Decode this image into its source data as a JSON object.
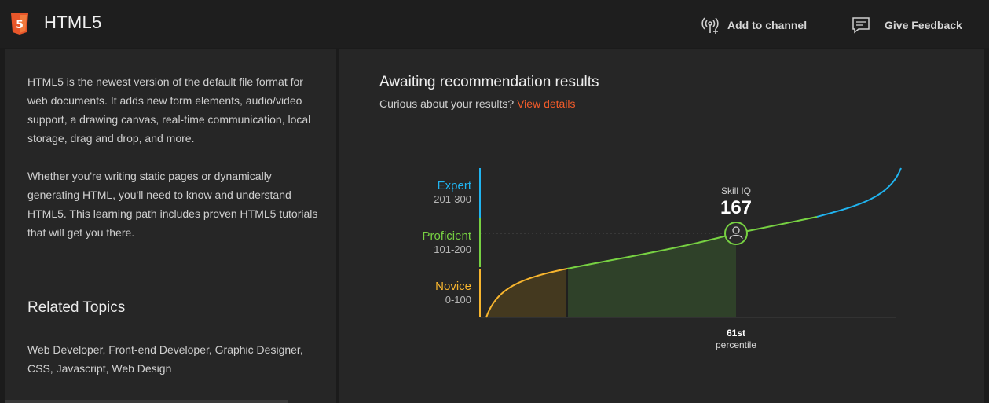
{
  "header": {
    "app_title": "HTML5",
    "logo_text": "5",
    "add_to_channel": "Add to channel",
    "give_feedback": "Give Feedback"
  },
  "left": {
    "desc_1": "HTML5 is the newest version of the default file format for web documents. It adds new form elements, audio/video support, a drawing canvas, real-time communication, local storage, drag and drop, and more.",
    "desc_2": "Whether you're writing static pages or dynamically generating HTML, you'll need to know and understand HTML5. This learning path includes proven HTML5 tutorials that will get you there.",
    "related_title": "Related Topics",
    "related_list": "Web Developer, Front-end Developer, Graphic Designer, CSS, Javascript, Web Design"
  },
  "right": {
    "title": "Awaiting recommendation results",
    "subtitle": "Curious about your results?",
    "link": "View details"
  },
  "skill": {
    "levels": [
      {
        "name": "Expert",
        "range": "201-300",
        "color": "#20b4f0"
      },
      {
        "name": "Proficient",
        "range": "101-200",
        "color": "#77d142"
      },
      {
        "name": "Novice",
        "range": "0-100",
        "color": "#f7b52e"
      }
    ],
    "skill_iq_label": "Skill IQ",
    "skill_iq_value": "167",
    "percentile_value": "61st",
    "percentile_label": "percentile"
  },
  "colors": {
    "accent": "#f15b2a",
    "expert": "#20b4f0",
    "proficient": "#77d142",
    "novice": "#f7b52e"
  }
}
